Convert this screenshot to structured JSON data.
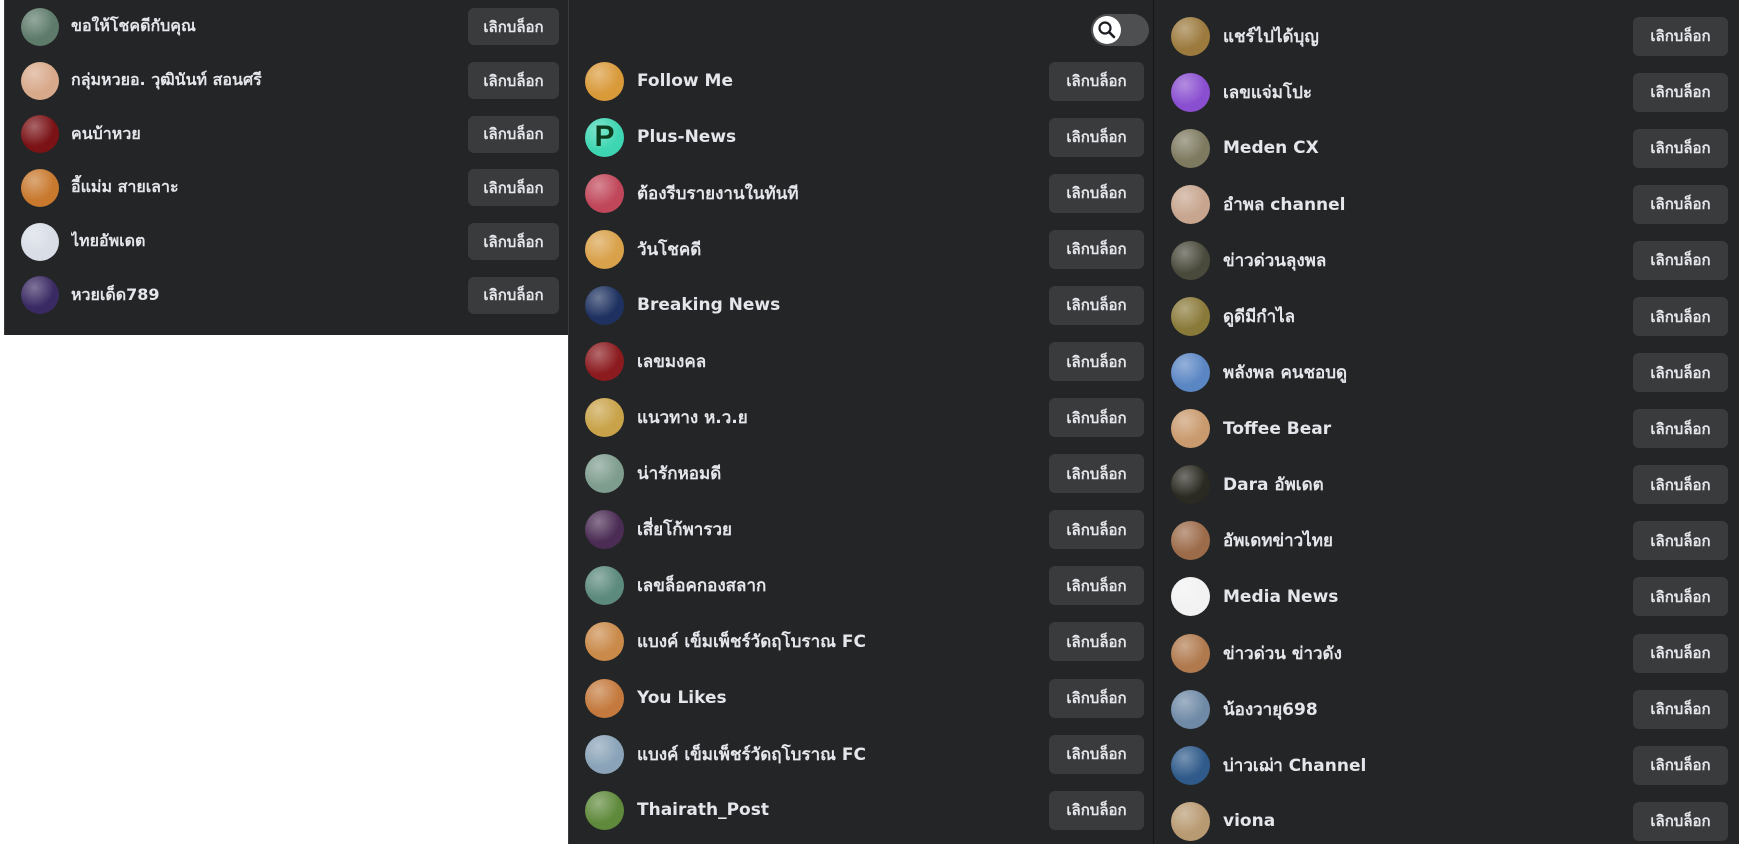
{
  "button_label": "เลิกบล็อก",
  "icons": {
    "search": "search-icon"
  },
  "colors": {
    "panel_bg": "#242526",
    "button_bg": "#3a3b3c",
    "text": "#e4e6eb"
  },
  "columns": [
    {
      "items": [
        {
          "name": "ขอให้โชคดีกับคุณ",
          "avatar_color": "#5d7a6a"
        },
        {
          "name": "กลุ่มหวยอ. วุฒินันท์ สอนศรี",
          "avatar_color": "#d8a98a"
        },
        {
          "name": "คนบ้าหวย",
          "avatar_color": "#7a1216"
        },
        {
          "name": "อี้แม่ม สายเลาะ",
          "avatar_color": "#c8792e"
        },
        {
          "name": "ไทยอัพเดต",
          "avatar_color": "#d8dde6"
        },
        {
          "name": "หวยเด็ด789",
          "avatar_color": "#3a2a63"
        }
      ]
    },
    {
      "items": [
        {
          "name": "Follow Me",
          "avatar_color": "#d99a3a"
        },
        {
          "name": "Plus-News",
          "avatar_color": "#3ed6b2",
          "avatar_letter": "P"
        },
        {
          "name": "ต้องรีบรายงานในทันที",
          "avatar_color": "#c0475a"
        },
        {
          "name": "วันโชคดี",
          "avatar_color": "#d9a14a"
        },
        {
          "name": "Breaking News",
          "avatar_color": "#1e3160"
        },
        {
          "name": "เลขมงคล",
          "avatar_color": "#8b1b1f"
        },
        {
          "name": "แนวทาง ห.ว.ย",
          "avatar_color": "#c9a34a"
        },
        {
          "name": "น่ารักหอมดี",
          "avatar_color": "#7f9d8f"
        },
        {
          "name": "เสี่ยโก้พารวย",
          "avatar_color": "#4b2c54"
        },
        {
          "name": "เลขล็อคกองสลาก",
          "avatar_color": "#5c8a7c"
        },
        {
          "name": "แบงค์ เข็มเพ็ชร์วัดฤโบราณ FC",
          "avatar_color": "#c98a4a"
        },
        {
          "name": "You Likes",
          "avatar_color": "#c47a3e"
        },
        {
          "name": "แบงค์ เข็มเพ็ชร์วัดฤโบราณ FC",
          "avatar_color": "#8aa3b8"
        },
        {
          "name": "Thairath_Post",
          "avatar_color": "#5f8a3c"
        }
      ]
    },
    {
      "items": [
        {
          "name": "แชร์ไปได้บุญ",
          "avatar_color": "#9c7a3e"
        },
        {
          "name": "เลขแจ่มโปะ",
          "avatar_color": "#8a4fd0"
        },
        {
          "name": "Meden CX",
          "avatar_color": "#7e7a60"
        },
        {
          "name": "อำพล channel",
          "avatar_color": "#c7a58e"
        },
        {
          "name": "ข่าวด่วนลุงพล",
          "avatar_color": "#4a4a3c"
        },
        {
          "name": "ดูดีมีกำไล",
          "avatar_color": "#8a7a3a"
        },
        {
          "name": "พลังพล คนชอบดู",
          "avatar_color": "#5b86c4"
        },
        {
          "name": "Toffee Bear",
          "avatar_color": "#c99a6e"
        },
        {
          "name": "Dara อัพเดต",
          "avatar_color": "#2b2a22"
        },
        {
          "name": "อัพเดทข่าวไทย",
          "avatar_color": "#9c6b4a"
        },
        {
          "name": "Media News",
          "avatar_color": "#f2f2f2"
        },
        {
          "name": "ข่าวด่วน ข่าวดัง",
          "avatar_color": "#b07a4e"
        },
        {
          "name": "น้องวายุ698",
          "avatar_color": "#6f8aa6"
        },
        {
          "name": "บ่าวเฌ่า Channel",
          "avatar_color": "#2f5a8a"
        },
        {
          "name": "viona",
          "avatar_color": "#b89a72"
        }
      ]
    }
  ]
}
